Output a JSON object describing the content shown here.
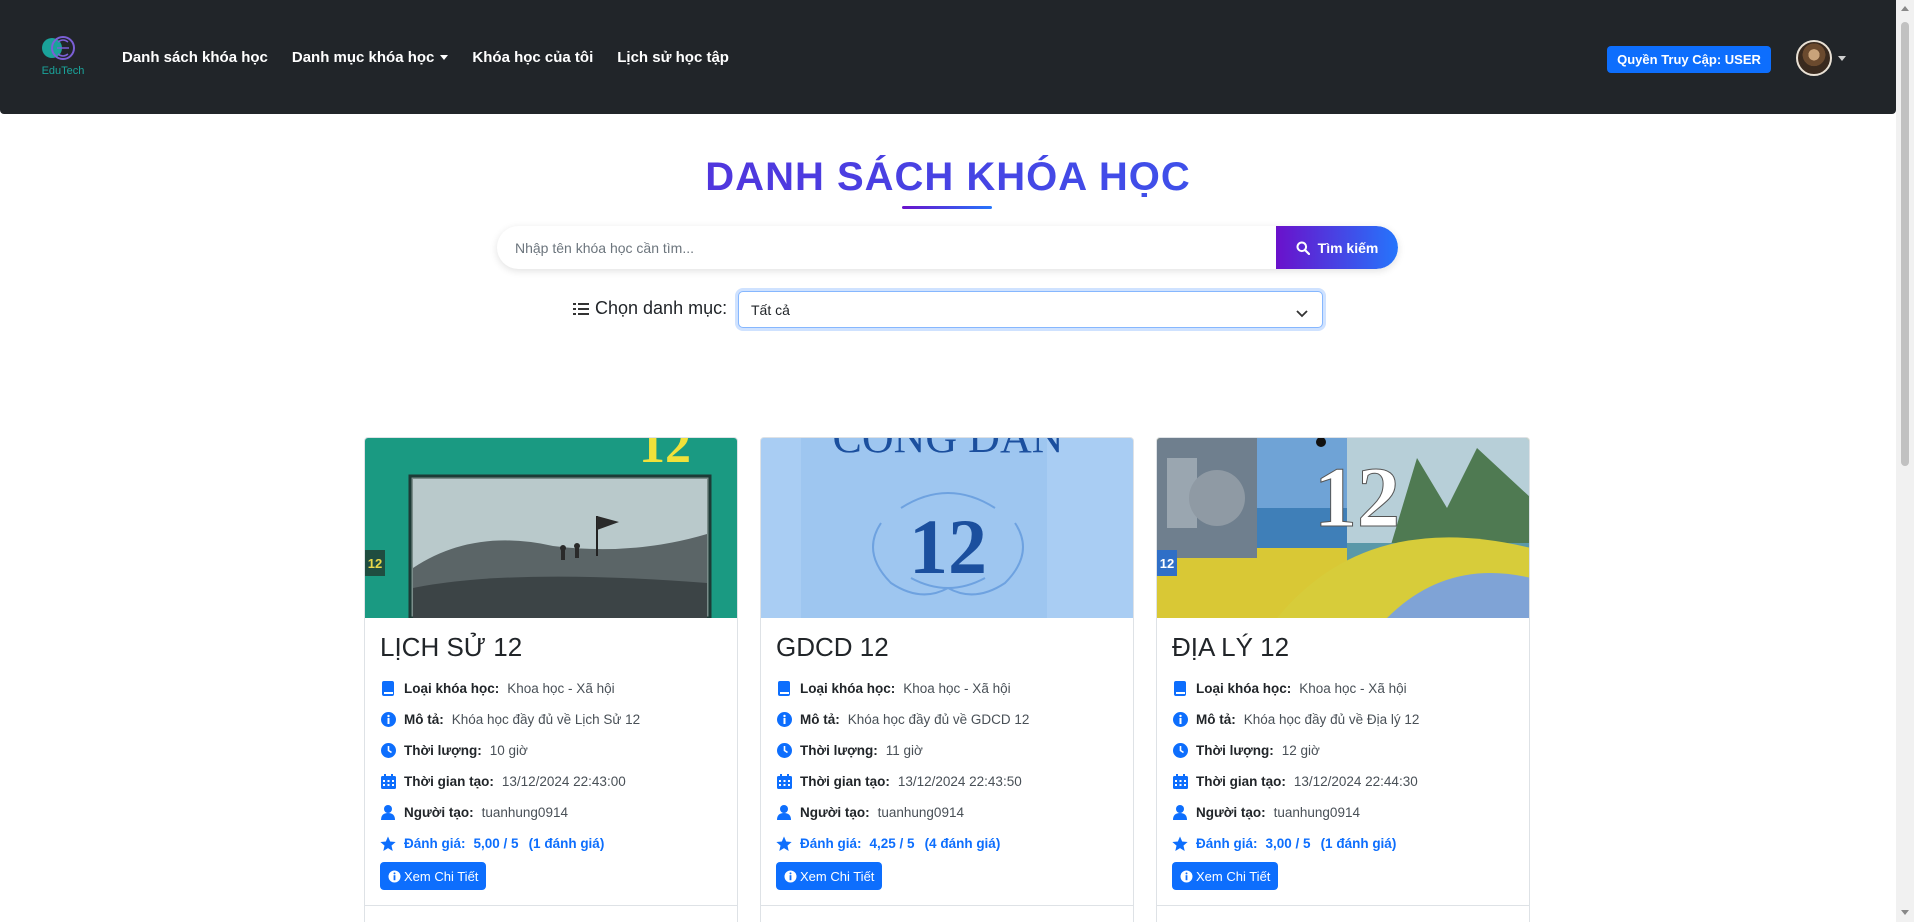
{
  "navbar": {
    "logo_text": "EduTech",
    "links": [
      "Danh sách khóa học",
      "Danh mục khóa học",
      "Khóa học của tôi",
      "Lịch sử học tập"
    ],
    "access_button": "Quyền Truy Cập: USER"
  },
  "page": {
    "title": "DANH SÁCH KHÓA HỌC"
  },
  "search": {
    "placeholder": "Nhập tên khóa học cần tìm...",
    "button_label": "Tìm kiếm"
  },
  "category": {
    "label": "Chọn danh mục:",
    "selected": "Tất cả"
  },
  "labels": {
    "type": "Loại khóa học:",
    "description": "Mô tả:",
    "duration": "Thời lượng:",
    "created_at": "Thời gian tạo:",
    "creator": "Người tạo:",
    "rating": "Đánh giá:",
    "detail_button": "Xem Chi Tiết"
  },
  "courses": [
    {
      "title": "LỊCH SỬ 12",
      "type": "Khoa học - Xã hội",
      "description": "Khóa học đầy đủ về Lịch Sử 12",
      "duration": "10 giờ",
      "created_at": "13/12/2024 22:43:00",
      "creator": "tuanhung0914",
      "rating": "5,00 / 5",
      "rating_count": "(1 đánh giá)",
      "cover_number": "12"
    },
    {
      "title": "GDCD 12",
      "type": "Khoa học - Xã hội",
      "description": "Khóa học đầy đủ về GDCD 12",
      "duration": "11 giờ",
      "created_at": "13/12/2024 22:43:50",
      "creator": "tuanhung0914",
      "rating": "4,25 / 5",
      "rating_count": "(4 đánh giá)",
      "cover_number": "12",
      "cover_text": "CÔNG DÂN"
    },
    {
      "title": "ĐỊA LÝ 12",
      "type": "Khoa học - Xã hội",
      "description": "Khóa học đầy đủ về Địa lý 12",
      "duration": "12 giờ",
      "created_at": "13/12/2024 22:44:30",
      "creator": "tuanhung0914",
      "rating": "3,00 / 5",
      "rating_count": "(1 đánh giá)",
      "cover_number": "12"
    }
  ],
  "colors": {
    "navbar": "#212529",
    "primary": "#0d6efd",
    "gradient_start": "#6a11cb",
    "gradient_end": "#2575fc"
  }
}
